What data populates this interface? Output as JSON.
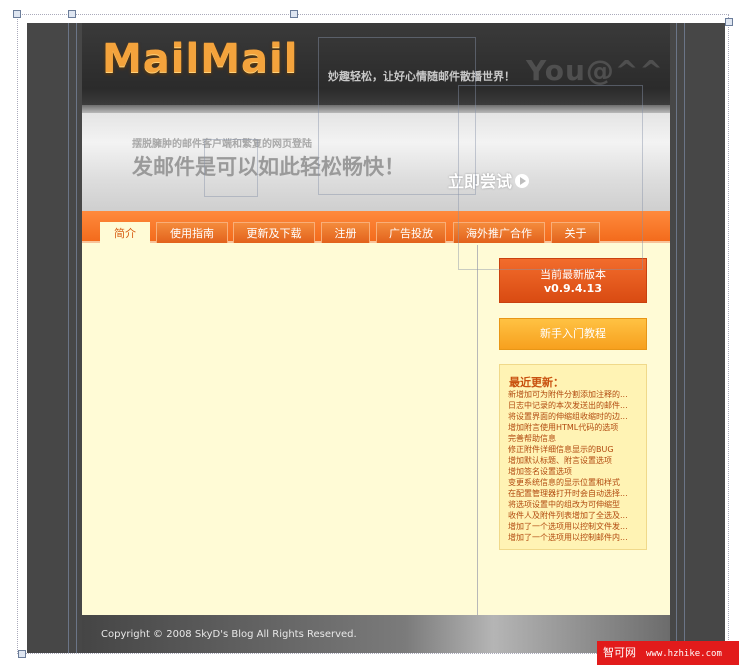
{
  "header": {
    "logo_text": "MailMail",
    "slogan": "妙趣轻松，让好心情随邮件散播世界！",
    "tagline": "You@^^"
  },
  "banner": {
    "subtitle": "摆脱臃肿的邮件客户端和繁复的网页登陆",
    "headline": "发邮件是可以如此轻松畅快！",
    "try_label": "立即尝试"
  },
  "nav": {
    "tabs": [
      {
        "label": "简介",
        "active": true
      },
      {
        "label": "使用指南",
        "active": false
      },
      {
        "label": "更新及下载",
        "active": false
      },
      {
        "label": "注册",
        "active": false
      },
      {
        "label": "广告投放",
        "active": false
      },
      {
        "label": "海外推广合作",
        "active": false
      },
      {
        "label": "关于",
        "active": false
      }
    ]
  },
  "sidebar": {
    "version_line1": "当前最新版本",
    "version_line2": "v0.9.4.13",
    "guide_label": "新手入门教程",
    "updates_title": "最近更新：",
    "updates": [
      "新增加可为附件分割添加注释的...",
      "日志中记录的本次发送出的邮件...",
      "将设置界面的伸缩组收缩时的边...",
      "增加附言使用HTML代码的选项",
      "完善帮助信息",
      "修正附件详细信息显示的BUG",
      "增加默认标题、附言设置选项",
      "增加签名设置选项",
      "变更系统信息的显示位置和样式",
      "在配置管理器打开时会自动选择...",
      "将选项设置中的组改为可伸缩型",
      "收件人及附件列表增加了全选及...",
      "增加了一个选项用以控制文件发...",
      "增加了一个选项用以控制邮件内..."
    ]
  },
  "footer": {
    "copyright": "Copyright © 2008 SkyD's Blog All Rights Reserved."
  },
  "watermark": {
    "site": "智可网",
    "url": "www.hzhike.com"
  },
  "colors": {
    "accent_orange": "#f36b1c",
    "page_background": "#fffbd6",
    "frame_dark": "#474747"
  }
}
